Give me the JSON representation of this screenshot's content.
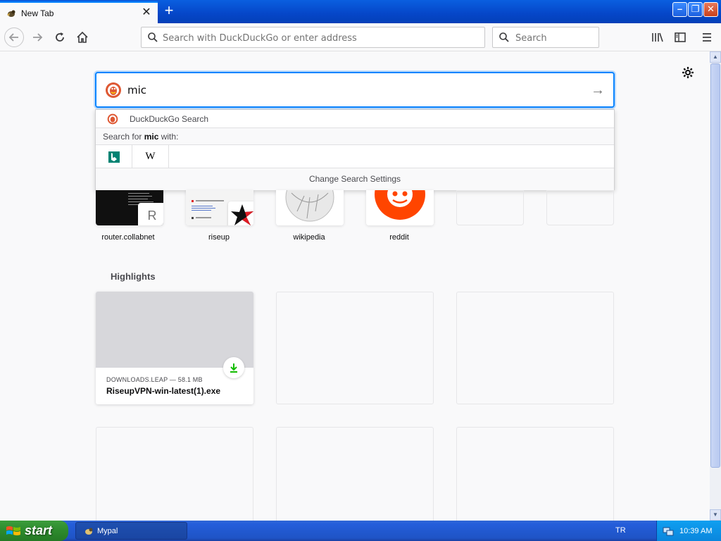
{
  "tab": {
    "title": "New Tab",
    "close": "✕",
    "new_tab": "+"
  },
  "window": {
    "minimize": "–",
    "maximize": "❐",
    "close": "✕"
  },
  "navbar": {
    "url_placeholder": "Search with DuckDuckGo or enter address",
    "search_placeholder": "Search"
  },
  "newtab_search": {
    "value": "mic",
    "go": "→"
  },
  "dropdown": {
    "engine_label": "DuckDuckGo Search",
    "search_for_prefix": "Search for ",
    "search_term": "mic",
    "search_for_suffix": " with:",
    "wiki_glyph": "W",
    "change_settings": "Change Search Settings"
  },
  "top_sites": [
    {
      "label": "router.collabnet",
      "badge": "R"
    },
    {
      "label": "riseup"
    },
    {
      "label": "wikipedia"
    },
    {
      "label": "reddit"
    },
    {
      "label": ""
    },
    {
      "label": ""
    }
  ],
  "highlights": {
    "title": "Highlights",
    "cards": [
      {
        "source": "DOWNLOADS.LEAP — 58.1 MB",
        "title": "RiseupVPN-win-latest(1).exe"
      }
    ]
  },
  "taskbar": {
    "start": "start",
    "task": "Mypal",
    "lang": "TR",
    "clock": "10:39 AM"
  },
  "colors": {
    "accent": "#0a84ff",
    "reddit": "#ff4500",
    "ddg": "#de5833",
    "bing": "#008373",
    "download": "#12bc00"
  }
}
